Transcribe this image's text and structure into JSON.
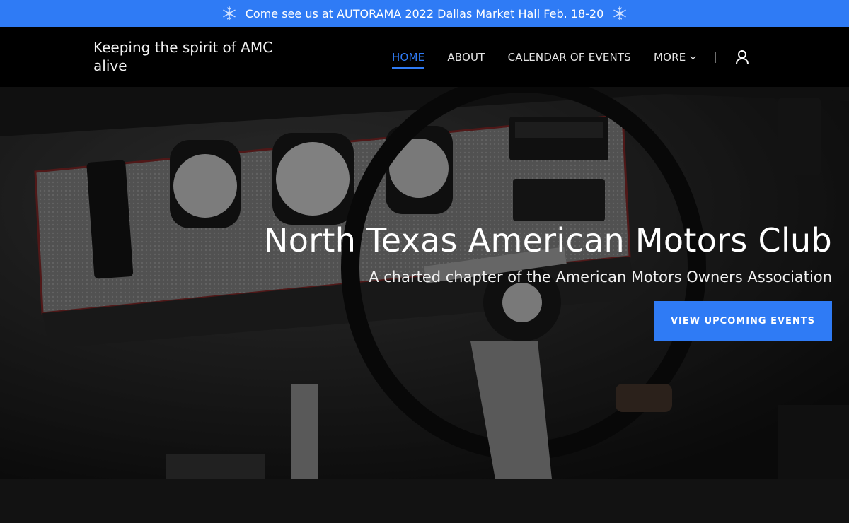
{
  "announcement": {
    "text": "Come see us at AUTORAMA 2022 Dallas Market Hall Feb. 18-20",
    "icon": "snowflake-icon",
    "background": "#2f7bf5"
  },
  "header": {
    "tagline": "Keeping the spirit of AMC alive",
    "nav": {
      "home": "HOME",
      "about": "ABOUT",
      "calendar": "CALENDAR OF EVENTS",
      "more": "MORE"
    },
    "active_item": "HOME",
    "account_icon": "user-icon",
    "accent": "#2f7bf5"
  },
  "hero": {
    "title": "North Texas American Motors Club",
    "subtitle": "A charted chapter of the American Motors Owners Association",
    "cta": "VIEW UPCOMING EVENTS",
    "background_image": "car dashboard and steering wheel"
  }
}
